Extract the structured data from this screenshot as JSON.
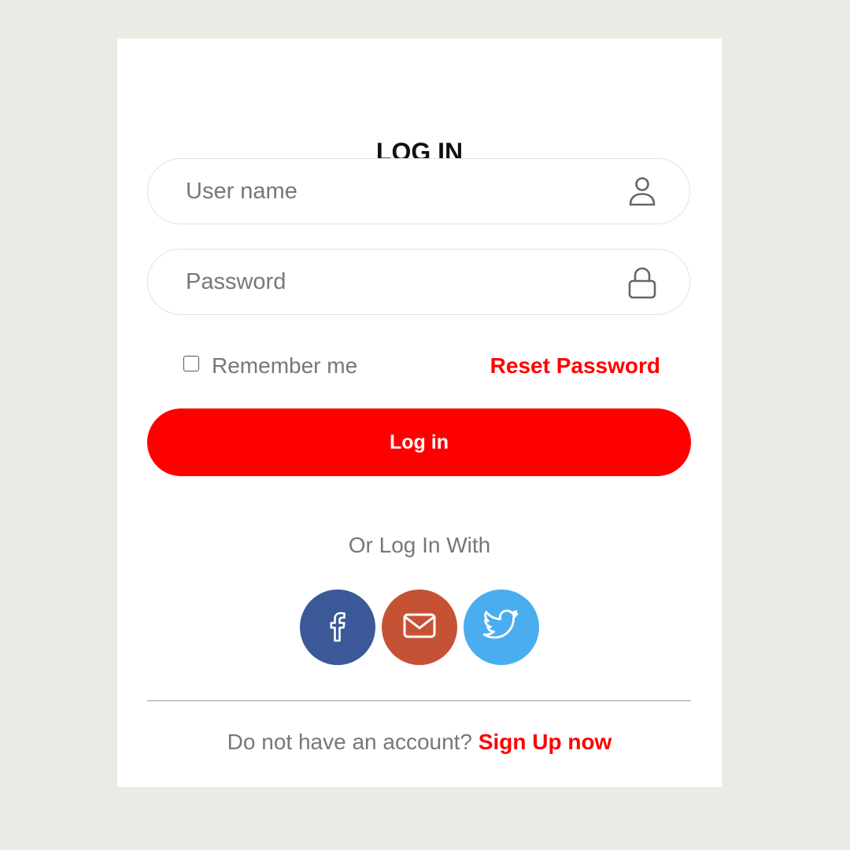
{
  "form": {
    "title": "LOG IN",
    "username": {
      "value": "",
      "placeholder": "User name",
      "icon": "user-icon"
    },
    "password": {
      "value": "",
      "placeholder": "Password",
      "icon": "lock-icon"
    },
    "remember_label": "Remember me",
    "remember_checked": false,
    "reset_label": "Reset Password",
    "login_label": "Log in",
    "or_text": "Or Log In With",
    "social": [
      {
        "icon": "facebook-icon",
        "color": "#3b5998"
      },
      {
        "icon": "mail-icon",
        "color": "#c65236"
      },
      {
        "icon": "twitter-icon",
        "color": "#4aadf0"
      }
    ],
    "signup_prompt": "Do not have an account?",
    "signup_link": "Sign Up now"
  },
  "colors": {
    "accent": "#ff0000",
    "background": "#ebebe6",
    "card": "#ffffff"
  }
}
